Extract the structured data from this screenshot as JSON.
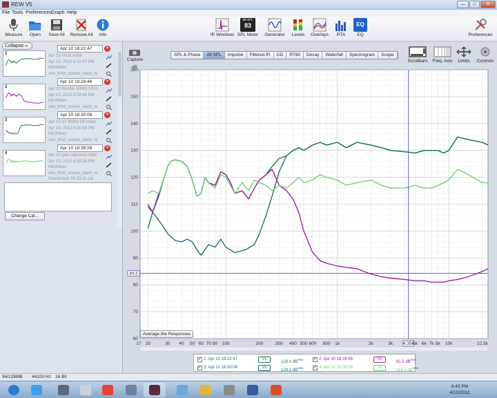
{
  "window": {
    "title": "REW V5",
    "minimize": "—",
    "maximize": "□",
    "close": "✕"
  },
  "menu": [
    "File",
    "Tools",
    "Preferences",
    "Graph",
    "Help"
  ],
  "toolbar": {
    "left": [
      {
        "label": "Measure",
        "icon": "microphone-icon"
      },
      {
        "label": "Open",
        "icon": "folder-open-icon"
      },
      {
        "label": "Save All",
        "icon": "save-icon"
      },
      {
        "label": "Remove All",
        "icon": "remove-icon"
      },
      {
        "label": "Info",
        "icon": "info-icon"
      }
    ],
    "center": [
      {
        "label": "IR Windows",
        "icon": "ir-window-icon"
      },
      {
        "label": "SPL Meter",
        "icon": "spl-meter-icon",
        "badge_top": "dB SPL",
        "badge_value": "83"
      },
      {
        "label": "Generator",
        "icon": "generator-icon"
      },
      {
        "label": "Levels",
        "icon": "levels-icon"
      },
      {
        "label": "Overlays",
        "icon": "overlays-icon"
      },
      {
        "label": "RTA",
        "icon": "rta-icon"
      },
      {
        "label": "EQ",
        "icon": "eq-icon",
        "badge_value": "EQ"
      }
    ],
    "right": {
      "label": "Preferences",
      "icon": "tools-icon"
    }
  },
  "sidebar": {
    "collapse_label": "Collapse",
    "measurements": [
      {
        "num": "1",
        "name": "Apr 10 18:22:47",
        "info": [
          "Apr 10 Initial.mdat",
          "Apr 10, 2012 6:22:47 PM",
          "Mic/Meter:",
          "one_third_octave_band_re"
        ],
        "color": "#1e7a4c"
      },
      {
        "num": "2",
        "name": "Apr 10 18:28:46",
        "info": [
          "Apr 10 Woofer 300hz LP.m",
          "Apr 10, 2012 6:28:46 PM",
          "Mic/Meter:",
          "one_third_octave_band_re"
        ],
        "color": "#a020a8"
      },
      {
        "num": "3",
        "name": "Apr 10 18:30:08",
        "info": [
          "Apr 10 AT 300hz HP.mdat",
          "Apr 10, 2012 6:30:08 PM",
          "Mic/Meter:",
          "one_third_octave_band_re"
        ],
        "color": "#1f6f7a"
      },
      {
        "num": "4",
        "name": "Apr 10 18:39:28",
        "info": [
          "Apr 10 gain adjusted.mdat",
          "Apr 10, 2012 6:39:28 PM",
          "Mic/Meter:",
          "one_third_octave_band_re",
          "Soundcard: 06.23.11.cal"
        ],
        "color": "#72d172"
      }
    ],
    "change_cal_label": "Change Cal..."
  },
  "capture": {
    "label": "Capture"
  },
  "tabs": [
    "SPL & Phase",
    "All SPL",
    "Impulse",
    "Filtered IR",
    "GD",
    "RT60",
    "Decay",
    "Waterfall",
    "Spectrogram",
    "Scope"
  ],
  "active_tab": "All SPL",
  "right_tools": [
    {
      "label": "Scrollbars",
      "icon": "scrollbars-icon"
    },
    {
      "label": "Freq. Axis",
      "icon": "grid-icon"
    },
    {
      "label": "Limits",
      "icon": "limits-icon"
    },
    {
      "label": "Controls",
      "icon": "controls-icon"
    }
  ],
  "average_button_label": "Average the Responses",
  "legend": [
    {
      "num": "1",
      "name": "1: Apr 10 18:22:47",
      "vs": "Vs",
      "value": "129.1 dB",
      "sup": "new",
      "color": "#1e7a4c"
    },
    {
      "num": "2",
      "name": "2: Apr 10 18:28:46",
      "vs": "Vs",
      "value": "81.5 dB",
      "sup": "new",
      "color": "#a020a8"
    },
    {
      "num": "3",
      "name": "3: Apr 10 18:30:08",
      "vs": "Vs",
      "value": "129.1 dB",
      "sup": "new",
      "color": "#1f6f7a"
    },
    {
      "num": "4",
      "name": "4: Apr 10 18:39:28",
      "vs": "Vs",
      "value": "118.2 dB",
      "sup": "new",
      "color": "#72d172"
    }
  ],
  "status": {
    "memory": "94/128MB",
    "rate": "44100 Hz",
    "bits": "16 Bit"
  },
  "clock": {
    "time": "6:43 PM",
    "date": "4/10/2012"
  },
  "taskbar_icons": [
    "start-orb-icon",
    "ie-icon",
    "user-icon",
    "media-player-icon",
    "chrome-icon",
    "sound-icon",
    "rew-icon",
    "app-icon",
    "folder-icon",
    "archive-icon",
    "dsp-icon",
    "paint-icon"
  ],
  "chart_data": {
    "type": "line",
    "ylabel": "dB",
    "ylim": [
      60,
      160
    ],
    "y_ticks": [
      60,
      70,
      80,
      90,
      100,
      110,
      120,
      130,
      140,
      150,
      160
    ],
    "xlim": [
      17,
      22500
    ],
    "x_scale": "log",
    "x_tick_labels": [
      "17",
      "20",
      "30",
      "40",
      "50",
      "60",
      "70",
      "80",
      "100",
      "200",
      "300",
      "400",
      "500",
      "600",
      "800",
      "1k",
      "2k",
      "3k",
      "4.35k",
      "5k",
      "6k",
      "7k",
      "8k",
      "10k",
      "22.5k"
    ],
    "x_ticks": [
      17,
      20,
      30,
      40,
      50,
      60,
      70,
      80,
      100,
      200,
      300,
      400,
      500,
      600,
      800,
      1000,
      2000,
      3000,
      4350,
      5000,
      6000,
      7000,
      8000,
      10000,
      22500
    ],
    "grid": true,
    "cursor": {
      "x": 4350,
      "x_label": "4.35k",
      "y": 84.3,
      "y_label": "84.3"
    },
    "series": [
      {
        "color": "#1f6f7a",
        "x": [
          20,
          22,
          25,
          28,
          30,
          32,
          35,
          40,
          45,
          50,
          55,
          60,
          70,
          80,
          90,
          100,
          120,
          150,
          180,
          200,
          230,
          260,
          300,
          350,
          400,
          450,
          500,
          600,
          700,
          800,
          1000,
          1200,
          1500,
          2000,
          2500,
          3000,
          4000,
          5000,
          6000,
          7000,
          8000,
          9000,
          10000,
          12000,
          15000,
          20000,
          22500
        ],
        "y": [
          109,
          107,
          104,
          101,
          99,
          98,
          96.5,
          96,
          97,
          96,
          93,
          91,
          95,
          94,
          97,
          94,
          92,
          93,
          95,
          99,
          106,
          113,
          122,
          128,
          130,
          131,
          130,
          132,
          133,
          132,
          133,
          131,
          133,
          132,
          131,
          130,
          129.5,
          129,
          130,
          130,
          130,
          129,
          130,
          135,
          134,
          133,
          132
        ]
      },
      {
        "color": "#1e7a4c",
        "x": [
          20,
          22,
          25,
          28,
          30,
          32,
          35,
          40,
          45,
          50,
          55,
          60,
          65,
          70,
          80,
          90,
          100,
          110,
          120,
          140,
          160,
          180,
          200,
          230,
          260,
          300,
          350,
          400,
          450,
          500,
          600,
          700,
          800,
          1000,
          1200,
          1500,
          2000,
          2500,
          3000,
          4000,
          5000,
          6000,
          7000,
          8000,
          9000,
          10000,
          12000,
          15000,
          20000,
          22500
        ],
        "y": [
          101,
          107,
          113,
          120,
          124,
          126,
          126.5,
          126,
          124,
          119,
          113,
          114,
          120,
          118,
          117,
          122,
          121,
          118,
          114,
          115,
          112,
          116,
          119,
          121,
          124,
          127,
          128,
          130,
          131,
          130,
          132,
          133,
          132,
          133,
          131,
          133,
          132,
          131,
          130,
          129.5,
          129,
          130,
          130,
          130,
          129,
          130,
          135,
          134,
          133,
          132
        ]
      },
      {
        "color": "#a020a8",
        "x": [
          20,
          22,
          25,
          28,
          30,
          32,
          35,
          40,
          45,
          50,
          55,
          60,
          65,
          70,
          80,
          90,
          100,
          110,
          120,
          140,
          160,
          180,
          200,
          230,
          260,
          300,
          350,
          400,
          450,
          500,
          600,
          700,
          800,
          1000,
          1200,
          1500,
          2000,
          2500,
          3000,
          4000,
          5000,
          6000,
          7000,
          8000,
          9000,
          10000,
          12000,
          15000,
          20000,
          22500
        ],
        "y": [
          110,
          107,
          114,
          120,
          124,
          126,
          126.5,
          126,
          124,
          119,
          113,
          114,
          120,
          118,
          117,
          122,
          121,
          118,
          114,
          115,
          112,
          116,
          119,
          121,
          123,
          117,
          115,
          112,
          107,
          100,
          92,
          89,
          88,
          87,
          86.5,
          86,
          84,
          83,
          82.5,
          82,
          81.5,
          81.5,
          81,
          81,
          81,
          81.5,
          82,
          83,
          85,
          86
        ]
      },
      {
        "color": "#72d172",
        "x": [
          20,
          22,
          25,
          28,
          30,
          32,
          35,
          40,
          45,
          50,
          55,
          60,
          65,
          70,
          80,
          90,
          100,
          110,
          120,
          140,
          160,
          180,
          200,
          230,
          260,
          300,
          350,
          400,
          450,
          500,
          600,
          700,
          800,
          1000,
          1200,
          1500,
          2000,
          2500,
          3000,
          4000,
          5000,
          6000,
          7000,
          8000,
          9000,
          10000,
          12000,
          15000,
          20000,
          22500
        ],
        "y": [
          114,
          115,
          114,
          120,
          124,
          126,
          126.5,
          126,
          124,
          119,
          113,
          114,
          120,
          118,
          116,
          121,
          120,
          117,
          114,
          118,
          115,
          119,
          118,
          117,
          115,
          117,
          116,
          118,
          120,
          118,
          119,
          121,
          120,
          119,
          117,
          118,
          119,
          117,
          116,
          116,
          117,
          116,
          116,
          117,
          118,
          119,
          123,
          121,
          118,
          118
        ]
      }
    ]
  }
}
